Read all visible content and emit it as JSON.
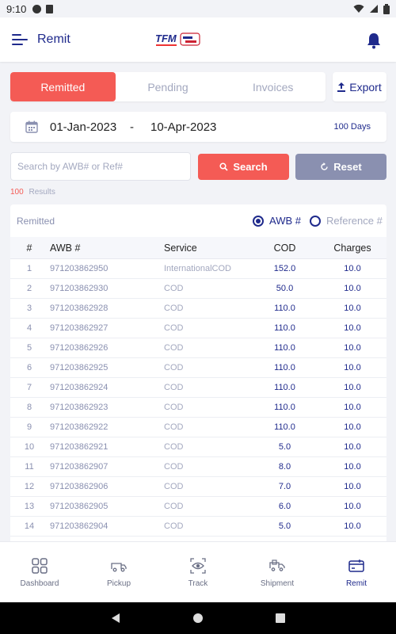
{
  "status_bar": {
    "time": "9:10"
  },
  "app_bar": {
    "title": "Remit"
  },
  "tabs": [
    {
      "label": "Remitted",
      "active": true
    },
    {
      "label": "Pending",
      "active": false
    },
    {
      "label": "Invoices",
      "active": false
    }
  ],
  "export": {
    "label": "Export"
  },
  "date_range": {
    "from": "01-Jan-2023",
    "separator": "-",
    "to": "10-Apr-2023",
    "days": "100 Days"
  },
  "search": {
    "placeholder": "Search by AWB# or Ref#",
    "value": "",
    "search_label": "Search",
    "reset_label": "Reset"
  },
  "results": {
    "count": "100",
    "label": "Results"
  },
  "table": {
    "card_label": "Remitted",
    "radio_awb": "AWB #",
    "radio_ref": "Reference #",
    "selected_radio": "AWB #",
    "headers": {
      "num": "#",
      "awb": "AWB #",
      "service": "Service",
      "cod": "COD",
      "charges": "Charges"
    },
    "rows": [
      {
        "num": "1",
        "awb": "971203862950",
        "service": "InternationalCOD",
        "cod": "152.0",
        "charges": "10.0"
      },
      {
        "num": "2",
        "awb": "971203862930",
        "service": "COD",
        "cod": "50.0",
        "charges": "10.0"
      },
      {
        "num": "3",
        "awb": "971203862928",
        "service": "COD",
        "cod": "110.0",
        "charges": "10.0"
      },
      {
        "num": "4",
        "awb": "971203862927",
        "service": "COD",
        "cod": "110.0",
        "charges": "10.0"
      },
      {
        "num": "5",
        "awb": "971203862926",
        "service": "COD",
        "cod": "110.0",
        "charges": "10.0"
      },
      {
        "num": "6",
        "awb": "971203862925",
        "service": "COD",
        "cod": "110.0",
        "charges": "10.0"
      },
      {
        "num": "7",
        "awb": "971203862924",
        "service": "COD",
        "cod": "110.0",
        "charges": "10.0"
      },
      {
        "num": "8",
        "awb": "971203862923",
        "service": "COD",
        "cod": "110.0",
        "charges": "10.0"
      },
      {
        "num": "9",
        "awb": "971203862922",
        "service": "COD",
        "cod": "110.0",
        "charges": "10.0"
      },
      {
        "num": "10",
        "awb": "971203862921",
        "service": "COD",
        "cod": "5.0",
        "charges": "10.0"
      },
      {
        "num": "11",
        "awb": "971203862907",
        "service": "COD",
        "cod": "8.0",
        "charges": "10.0"
      },
      {
        "num": "12",
        "awb": "971203862906",
        "service": "COD",
        "cod": "7.0",
        "charges": "10.0"
      },
      {
        "num": "13",
        "awb": "971203862905",
        "service": "COD",
        "cod": "6.0",
        "charges": "10.0"
      },
      {
        "num": "14",
        "awb": "971203862904",
        "service": "COD",
        "cod": "5.0",
        "charges": "10.0"
      }
    ]
  },
  "bottom_nav": [
    {
      "label": "Dashboard",
      "icon": "dashboard-icon",
      "active": false
    },
    {
      "label": "Pickup",
      "icon": "pickup-icon",
      "active": false
    },
    {
      "label": "Track",
      "icon": "track-icon",
      "active": false
    },
    {
      "label": "Shipment",
      "icon": "shipment-icon",
      "active": false
    },
    {
      "label": "Remit",
      "icon": "remit-icon",
      "active": true
    }
  ],
  "colors": {
    "primary": "#1f2a8c",
    "accent": "#f45b55",
    "muted": "#8a90b0",
    "background": "#f2f3f7"
  }
}
